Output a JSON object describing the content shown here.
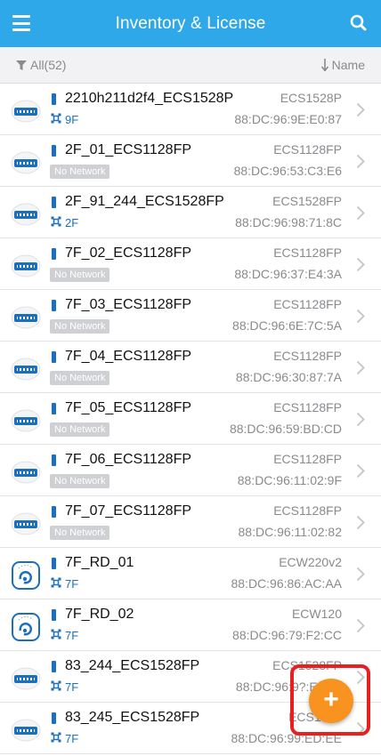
{
  "header": {
    "title": "Inventory & License",
    "menu_icon": "menu-icon",
    "search_icon": "search-icon"
  },
  "filter": {
    "label": "All(52)",
    "sort_label": "Name"
  },
  "colors": {
    "header": "#2ea8e8",
    "location": "#1c6fbf",
    "fab": "#f7931e",
    "highlight": "#e82020"
  },
  "devices": [
    {
      "name": "2210h211d2f4_ECS1528P",
      "type": "switch",
      "location": "9F",
      "no_network": "",
      "model": "ECS1528P",
      "mac": "88:DC:96:9E:E0:87"
    },
    {
      "name": "2F_01_ECS1128FP",
      "type": "switch",
      "location": "",
      "no_network": "No Network",
      "model": "ECS1128FP",
      "mac": "88:DC:96:53:C3:E6"
    },
    {
      "name": "2F_91_244_ECS1528FP",
      "type": "switch",
      "location": "2F",
      "no_network": "",
      "model": "ECS1528FP",
      "mac": "88:DC:96:98:71:8C"
    },
    {
      "name": "7F_02_ECS1128FP",
      "type": "switch",
      "location": "",
      "no_network": "No Network",
      "model": "ECS1128FP",
      "mac": "88:DC:96:37:E4:3A"
    },
    {
      "name": "7F_03_ECS1128FP",
      "type": "switch",
      "location": "",
      "no_network": "No Network",
      "model": "ECS1128FP",
      "mac": "88:DC:96:6E:7C:5A"
    },
    {
      "name": "7F_04_ECS1128FP",
      "type": "switch",
      "location": "",
      "no_network": "No Network",
      "model": "ECS1128FP",
      "mac": "88:DC:96:30:87:7A"
    },
    {
      "name": "7F_05_ECS1128FP",
      "type": "switch",
      "location": "",
      "no_network": "No Network",
      "model": "ECS1128FP",
      "mac": "88:DC:96:59:BD:CD"
    },
    {
      "name": "7F_06_ECS1128FP",
      "type": "switch",
      "location": "",
      "no_network": "No Network",
      "model": "ECS1128FP",
      "mac": "88:DC:96:11:02:9F"
    },
    {
      "name": "7F_07_ECS1128FP",
      "type": "switch",
      "location": "",
      "no_network": "No Network",
      "model": "ECS1128FP",
      "mac": "88:DC:96:11:02:82"
    },
    {
      "name": "7F_RD_01",
      "type": "ap",
      "location": "7F",
      "no_network": "",
      "model": "ECW220v2",
      "mac": "88:DC:96:86:AC:AA"
    },
    {
      "name": "7F_RD_02",
      "type": "ap",
      "location": "7F",
      "no_network": "",
      "model": "ECW120",
      "mac": "88:DC:96:79:F2:CC"
    },
    {
      "name": "83_244_ECS1528FP",
      "type": "switch",
      "location": "7F",
      "no_network": "",
      "model": "ECS1528FP",
      "mac": "88:DC:96:9?:E?:??"
    },
    {
      "name": "83_245_ECS1528FP",
      "type": "switch",
      "location": "7F",
      "no_network": "",
      "model": "ECS1528",
      "mac": "88:DC:96:99:ED:EE"
    }
  ],
  "fab": {
    "label": "+"
  }
}
